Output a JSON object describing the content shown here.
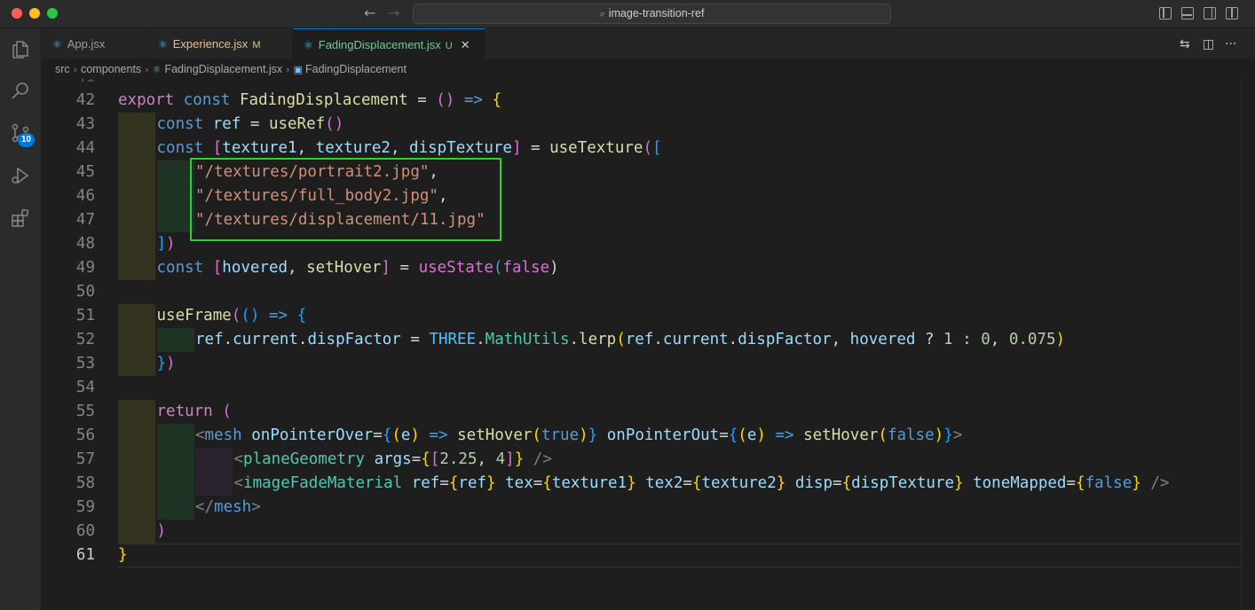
{
  "window": {
    "search_text": "image-transition-ref"
  },
  "activity_bar": {
    "scm_badge": "10",
    "items": [
      "files-icon",
      "search-icon",
      "source-control-icon",
      "run-debug-icon",
      "extensions-icon"
    ]
  },
  "tabs": [
    {
      "label": "App.jsx",
      "status": ""
    },
    {
      "label": "Experience.jsx",
      "status": "M"
    },
    {
      "label": "FadingDisplacement.jsx",
      "status": "U",
      "active": true
    }
  ],
  "breadcrumb": {
    "part1": "src",
    "part2": "components",
    "part3": "FadingDisplacement.jsx",
    "part4": "FadingDisplacement"
  },
  "editor": {
    "active_line": "61",
    "lines": [
      {
        "n": "42",
        "t": [
          "export",
          " ",
          "const",
          " ",
          "FadingDisplacement",
          " = ",
          "()",
          " ",
          "=>",
          " ",
          "{"
        ]
      },
      {
        "n": "43",
        "t": [
          "const",
          " ",
          "ref",
          " = ",
          "useRef",
          "()"
        ]
      },
      {
        "n": "44",
        "t": [
          "const",
          " ",
          "[",
          "texture1",
          ", ",
          "texture2",
          ", ",
          "dispTexture",
          "]",
          " = ",
          "useTexture",
          "(",
          "["
        ]
      },
      {
        "n": "45",
        "t": [
          "\"/textures/portrait2.jpg\"",
          ","
        ]
      },
      {
        "n": "46",
        "t": [
          "\"/textures/full_body2.jpg\"",
          ","
        ]
      },
      {
        "n": "47",
        "t": [
          "\"/textures/displacement/11.jpg\""
        ]
      },
      {
        "n": "48",
        "t": [
          "]",
          ")"
        ]
      },
      {
        "n": "49",
        "t": [
          "const",
          " ",
          "[",
          "hovered",
          ", ",
          "setHover",
          "]",
          " = ",
          "useState",
          "(",
          "false",
          ")"
        ]
      },
      {
        "n": "50",
        "t": []
      },
      {
        "n": "51",
        "t": [
          "useFrame",
          "(",
          "()",
          " ",
          "=>",
          " ",
          "{"
        ]
      },
      {
        "n": "52",
        "t": [
          "ref",
          ".",
          "current",
          ".",
          "dispFactor",
          " = ",
          "THREE",
          ".",
          "MathUtils",
          ".",
          "lerp",
          "(",
          "ref",
          ".",
          "current",
          ".",
          "dispFactor",
          ", ",
          "hovered",
          " ? ",
          "1",
          " : ",
          "0",
          ", ",
          "0.075",
          ")"
        ]
      },
      {
        "n": "53",
        "t": [
          "}",
          ")"
        ]
      },
      {
        "n": "54",
        "t": []
      },
      {
        "n": "55",
        "t": [
          "return",
          " ",
          "("
        ]
      },
      {
        "n": "56",
        "t": [
          "<",
          "mesh",
          " ",
          "onPointerOver",
          "=",
          "{",
          "(",
          "e",
          ")",
          " ",
          "=>",
          " ",
          "setHover",
          "(",
          "true",
          ")",
          "}",
          " ",
          "onPointerOut",
          "=",
          "{",
          "(",
          "e",
          ")",
          " ",
          "=>",
          " ",
          "setHover",
          "(",
          "false",
          ")",
          "}",
          ">"
        ]
      },
      {
        "n": "57",
        "t": [
          "<",
          "planeGeometry",
          " ",
          "args",
          "=",
          "{",
          "[",
          "2.25",
          ", ",
          "4",
          "]",
          "}",
          " ",
          "/>"
        ]
      },
      {
        "n": "58",
        "t": [
          "<",
          "imageFadeMaterial",
          " ",
          "ref",
          "=",
          "{",
          "ref",
          "}",
          " ",
          "tex",
          "=",
          "{",
          "texture1",
          "}",
          " ",
          "tex2",
          "=",
          "{",
          "texture2",
          "}",
          " ",
          "disp",
          "=",
          "{",
          "dispTexture",
          "}",
          " ",
          "toneMapped",
          "=",
          "{",
          "false",
          "}",
          " ",
          "/>"
        ]
      },
      {
        "n": "59",
        "t": [
          "</",
          "mesh",
          ">"
        ]
      },
      {
        "n": "60",
        "t": [
          ")"
        ]
      },
      {
        "n": "61",
        "t": [
          "}"
        ]
      }
    ]
  }
}
